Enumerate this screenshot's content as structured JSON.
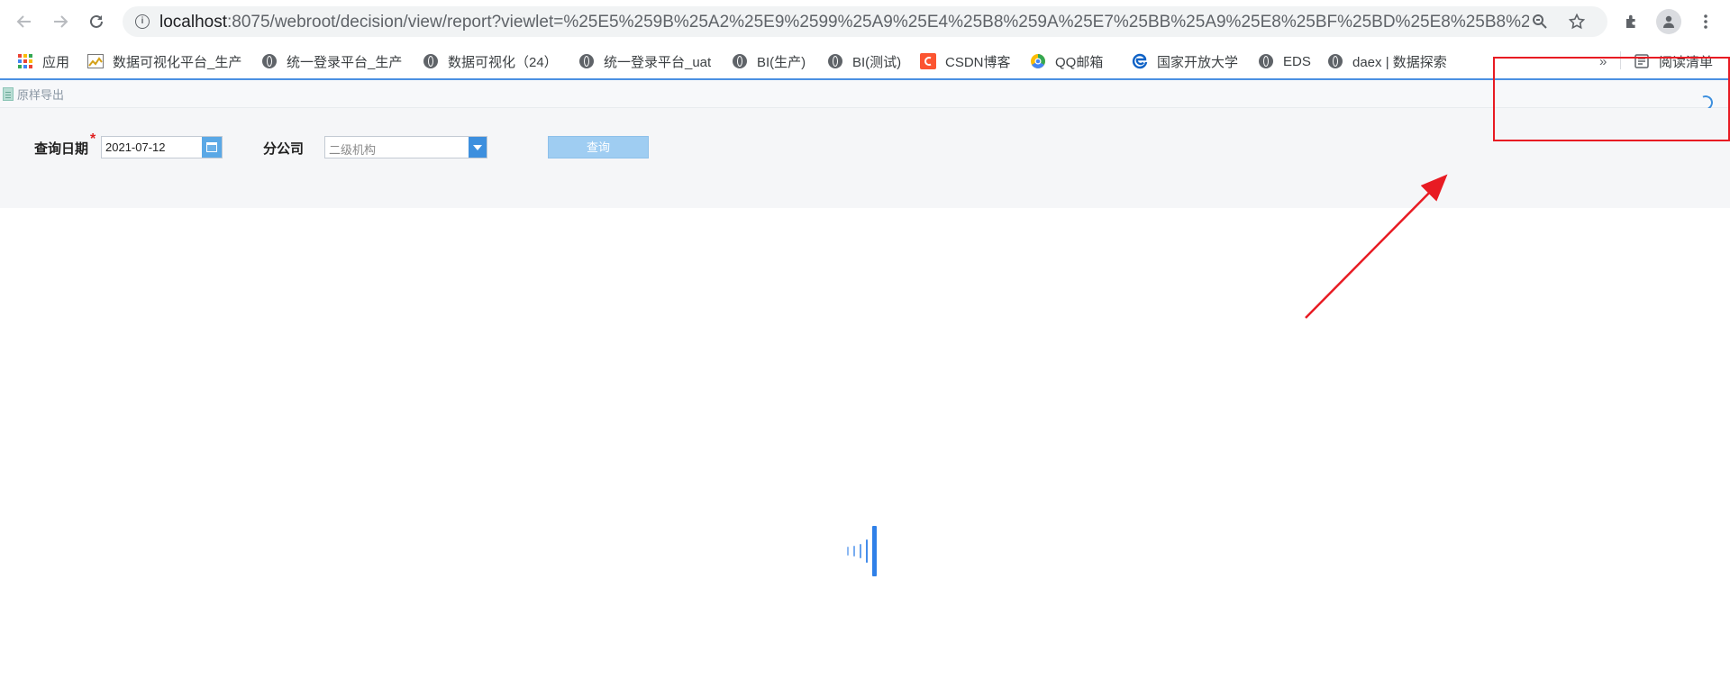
{
  "browser": {
    "url_host": "localhost",
    "url_rest": ":8075/webroot/decision/view/report?viewlet=%25E5%259B%25A2%25E9%2599%25A9%25E4%25B8%259A%25E7%25BB%25A9%25E8%25BF%25BD%25E8%25B8%25AA..."
  },
  "bookmarks": {
    "items": [
      {
        "label": "应用",
        "icon": "apps-grid-icon"
      },
      {
        "label": "数据可视化平台_生产",
        "icon": "chart-favicon"
      },
      {
        "label": "统一登录平台_生产",
        "icon": "globe-icon"
      },
      {
        "label": "数据可视化（24）",
        "icon": "globe-icon"
      },
      {
        "label": "统一登录平台_uat",
        "icon": "globe-icon"
      },
      {
        "label": "BI(生产)",
        "icon": "globe-icon"
      },
      {
        "label": "BI(测试)",
        "icon": "globe-icon"
      },
      {
        "label": "CSDN博客",
        "icon": "csdn-icon"
      },
      {
        "label": "QQ邮箱",
        "icon": "qq-mail-icon"
      },
      {
        "label": "国家开放大学",
        "icon": "edge-icon"
      },
      {
        "label": "EDS",
        "icon": "globe-icon"
      },
      {
        "label": "daex | 数据探索",
        "icon": "globe-icon"
      }
    ],
    "overflow": "»",
    "reading_list": "阅读清单"
  },
  "report": {
    "export_label": "原样导出",
    "params": {
      "date_label": "查询日期",
      "date_required_mark": "*",
      "date_value": "2021-07-12",
      "branch_label": "分公司",
      "branch_placeholder": "二级机构",
      "query_label": "查询"
    }
  },
  "colors": {
    "accent": "#3d8fde",
    "annotation": "#e81b23",
    "query_disabled": "#9fcdf2"
  }
}
